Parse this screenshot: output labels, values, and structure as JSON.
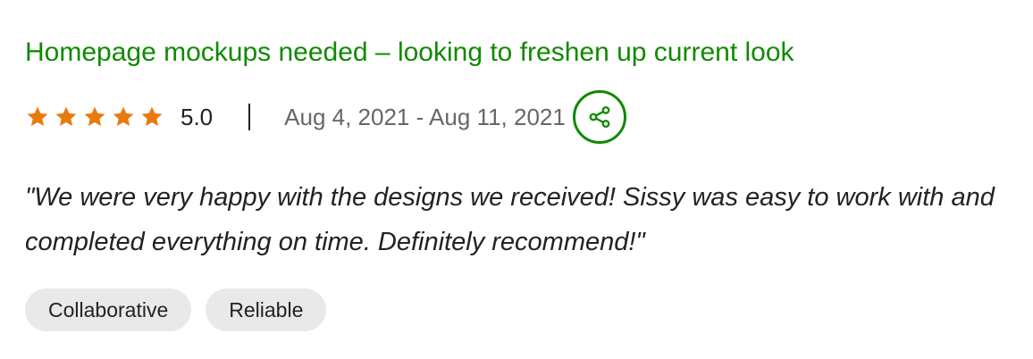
{
  "review": {
    "title": "Homepage mockups needed – looking to freshen up current look",
    "rating": {
      "stars_filled": 5,
      "stars_total": 5,
      "value_label": "5.0",
      "star_color": "#e87b0c"
    },
    "date_range": "Aug 4, 2021 - Aug 11, 2021",
    "share_icon": "share-icon",
    "quote": "\"We were very happy with the designs we received! Sissy was easy to work with and completed everything on time. Definitely recommend!\"",
    "tags": [
      {
        "label": "Collaborative"
      },
      {
        "label": "Reliable"
      }
    ]
  },
  "colors": {
    "accent": "#108a00",
    "star": "#e87b0c",
    "tag_bg": "#e9e9e9"
  }
}
